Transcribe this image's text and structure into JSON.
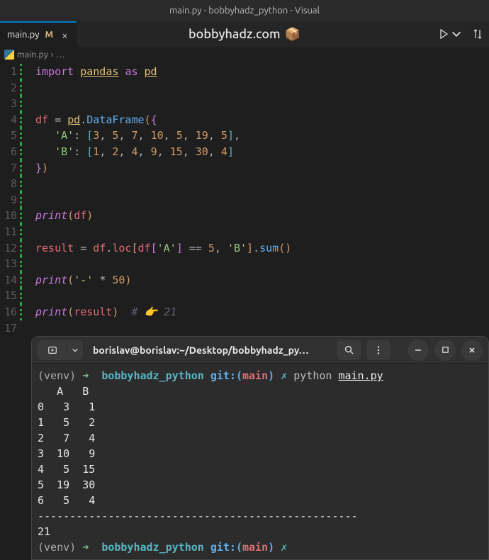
{
  "window": {
    "title": "main.py - bobbyhadz_python - Visual"
  },
  "tab": {
    "filename": "main.py",
    "modified_marker": "M",
    "close_glyph": "×"
  },
  "site": {
    "label": "bobbyhadz.com",
    "cube": "📦"
  },
  "breadcrumb": {
    "file": "main.py",
    "sep": "›",
    "rest": "…"
  },
  "code": {
    "line_count": 17,
    "lines": {
      "l1": {
        "import": "import",
        "pandas": "pandas",
        "as": "as",
        "pd": "pd"
      },
      "l4": {
        "df": "df",
        "eq": "=",
        "pd": "pd",
        "dot": ".",
        "fn": "DataFrame",
        "open": "({"
      },
      "l5": {
        "key": "'A'",
        "colon": ":",
        "open": "[",
        "vals": "3, 5, 7, 10, 5, 19, 5",
        "close": "],",
        "n1": "3",
        "n2": "5",
        "n3": "7",
        "n4": "10",
        "n5": "5",
        "n6": "19",
        "n7": "5"
      },
      "l6": {
        "key": "'B'",
        "colon": ":",
        "open": "[",
        "n1": "1",
        "n2": "2",
        "n3": "4",
        "n4": "9",
        "n5": "15",
        "n6": "30",
        "n7": "4",
        "close": "]"
      },
      "l7": {
        "close": "})"
      },
      "l10": {
        "print": "print",
        "arg": "df"
      },
      "l12": {
        "result": "result",
        "eq": "=",
        "df": "df",
        "loc": "loc",
        "dfk": "df",
        "key": "'A'",
        "eqeq": "==",
        "five": "5",
        "keyB": "'B'",
        "sum": "sum"
      },
      "l14": {
        "print": "print",
        "dash": "'-'",
        "star": "*",
        "fifty": "50"
      },
      "l16": {
        "print": "print",
        "arg": "result",
        "comment_hash": "#",
        "comment_emoji": "👉",
        "comment_val": "21"
      }
    }
  },
  "terminal": {
    "title": "borislav@borislav:~/Desktop/bobbyhadz_py…",
    "prompt": {
      "venv": "(venv)",
      "arrow": "➜",
      "dir": "bobbyhadz_python",
      "git": "git:(",
      "branch": "main",
      "gitclose": ")",
      "dirty": "✗",
      "cmd": "python",
      "arg": "main.py"
    },
    "output_header": "   A   B",
    "output_rows": [
      "0   3   1",
      "1   5   2",
      "2   7   4",
      "3  10   9",
      "4   5  15",
      "5  19  30",
      "6   5   4"
    ],
    "separator": "--------------------------------------------------",
    "result": "21"
  }
}
